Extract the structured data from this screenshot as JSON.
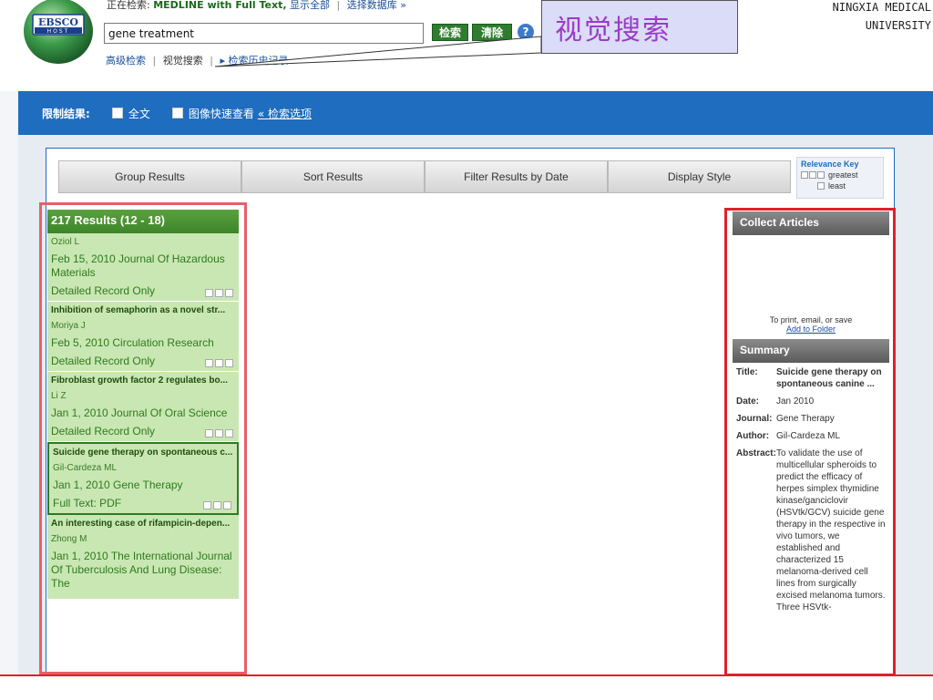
{
  "header": {
    "logo_text": "EBSCO",
    "logo_sub": "HOST",
    "searching_prefix": "正在检索:",
    "database": "MEDLINE with Full Text,",
    "show_all": "显示全部",
    "choose_db": "选择数据库 »",
    "search_value": "gene treatment",
    "search_button": "检索",
    "clear_button": "清除",
    "help": "?",
    "advanced": "高级检索",
    "visual": "视觉搜索",
    "history": "▸ 检索历史记录",
    "university_line1": "NINGXIA MEDICAL",
    "university_line2": "UNIVERSITY",
    "callout_text": "视觉搜索"
  },
  "limiters": {
    "label": "限制结果:",
    "full_text": "全文",
    "image_quick": "图像快速查看",
    "options_link": "« 检索选项"
  },
  "toolbar": {
    "group": "Group Results",
    "sort": "Sort Results",
    "filter": "Filter Results by Date",
    "display": "Display Style"
  },
  "relevance_key": {
    "title": "Relevance Key",
    "greatest": "greatest",
    "least": "least"
  },
  "results": {
    "header": "217 Results (12 - 18)",
    "items": [
      {
        "title": "",
        "author": "Oziol L",
        "source": "Feb 15, 2010 Journal Of Hazardous Materials",
        "record": "Detailed Record Only"
      },
      {
        "title": "Inhibition of semaphorin as a novel str...",
        "author": "Moriya J",
        "source": "Feb 5, 2010 Circulation Research",
        "record": "Detailed Record Only"
      },
      {
        "title": "Fibroblast growth factor 2 regulates bo...",
        "author": "Li Z",
        "source": "Jan 1, 2010 Journal Of Oral Science",
        "record": "Detailed Record Only"
      },
      {
        "title": "Suicide gene therapy on spontaneous c...",
        "author": "Gil-Cardeza ML",
        "source": "Jan 1, 2010 Gene Therapy",
        "record": "Full Text: PDF"
      },
      {
        "title": "An interesting case of rifampicin-depen...",
        "author": "Zhong M",
        "source": "Jan 1, 2010 The International Journal Of Tuberculosis And Lung Disease: The",
        "record": ""
      }
    ]
  },
  "collect": {
    "header": "Collect Articles",
    "hint": "To print, email, or save",
    "add_link": "Add to Folder"
  },
  "summary": {
    "header": "Summary",
    "title_label": "Title:",
    "title_value": "Suicide gene therapy on spontaneous canine ...",
    "date_label": "Date:",
    "date_value": "Jan 2010",
    "journal_label": "Journal:",
    "journal_value": "Gene Therapy",
    "author_label": "Author:",
    "author_value": "Gil-Cardeza ML",
    "abstract_label": "Abstract:",
    "abstract_value": "To validate the use of multicellular spheroids to predict the efficacy of herpes simplex thymidine kinase/ganciclovir (HSVtk/GCV) suicide gene therapy in the respective in vivo tumors, we established and characterized 15 melanoma-derived cell lines from surgically excised melanoma tumors. Three HSVtk-"
  },
  "colors": {
    "brand_blue": "#1e6dbf",
    "result_green": "#c9e7b3",
    "highlight_red": "#e0202a"
  }
}
